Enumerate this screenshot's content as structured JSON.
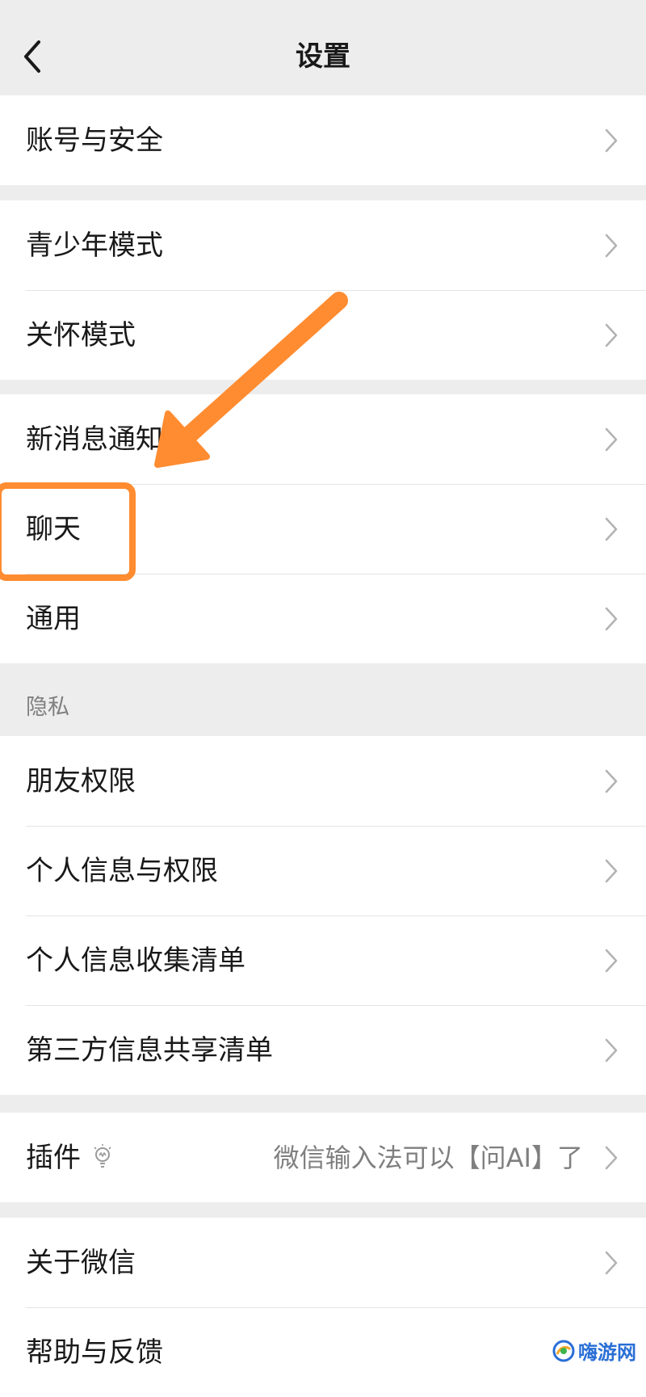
{
  "header": {
    "title": "设置"
  },
  "groups": [
    {
      "items": [
        {
          "label": "账号与安全"
        }
      ]
    },
    {
      "items": [
        {
          "label": "青少年模式"
        },
        {
          "label": "关怀模式"
        }
      ]
    },
    {
      "items": [
        {
          "label": "新消息通知"
        },
        {
          "label": "聊天"
        },
        {
          "label": "通用"
        }
      ]
    },
    {
      "section_header": "隐私",
      "items": [
        {
          "label": "朋友权限"
        },
        {
          "label": "个人信息与权限"
        },
        {
          "label": "个人信息收集清单"
        },
        {
          "label": "第三方信息共享清单"
        }
      ]
    },
    {
      "items": [
        {
          "label": "插件",
          "value": "微信输入法可以【问AI】了"
        }
      ]
    },
    {
      "items": [
        {
          "label": "关于微信"
        },
        {
          "label": "帮助与反馈"
        }
      ]
    }
  ],
  "annotation": {
    "highlight_color": "#ff8c31"
  },
  "watermark": {
    "text": "嗨游网"
  }
}
